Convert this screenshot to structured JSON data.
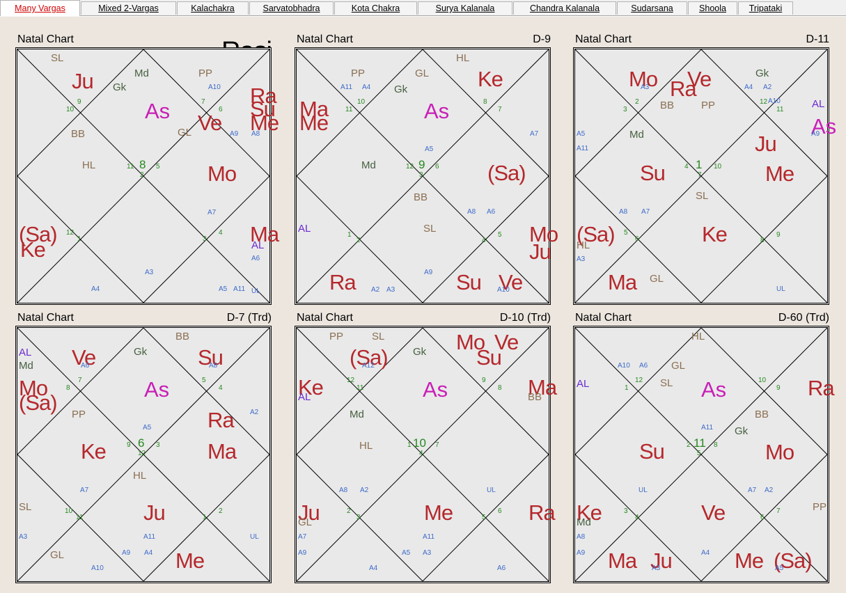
{
  "tabs": [
    {
      "label": "Many Vargas",
      "active": true
    },
    {
      "label": "Mixed 2-Vargas"
    },
    {
      "label": "Kalachakra"
    },
    {
      "label": "Sarvatobhadra"
    },
    {
      "label": "Kota Chakra"
    },
    {
      "label": "Surya Kalanala"
    },
    {
      "label": "Chandra Kalanala"
    },
    {
      "label": "Sudarsana"
    },
    {
      "label": "Shoola"
    },
    {
      "label": "Tripataki"
    }
  ],
  "colors": {
    "planet": "#b5282c",
    "ascendant": "#c81fb6",
    "special_lagna": "#8b6f52",
    "arudha": "#3d6bc9",
    "house_number": "#26881f",
    "arudha_lagna": "#6b2bd0",
    "chart_bg": "#e9e9e9",
    "window_bg": "#ece6df"
  },
  "charts": [
    {
      "title": "Natal Chart",
      "varga": "Rasi",
      "items": [
        {
          "t": "SL",
          "c": "spec"
        },
        {
          "t": "Ju",
          "c": "planet"
        },
        {
          "t": "Md",
          "c": "spec2"
        },
        {
          "t": "Gk",
          "c": "spec2"
        },
        {
          "t": "PP",
          "c": "spec"
        },
        {
          "t": "A10",
          "c": "arud"
        },
        {
          "t": "Ra",
          "c": "planet"
        },
        {
          "t": "Su",
          "c": "planet"
        },
        {
          "t": "Me",
          "c": "planet"
        },
        {
          "t": "9",
          "c": "hn"
        },
        {
          "t": "10",
          "c": "hn"
        },
        {
          "t": "7",
          "c": "hn"
        },
        {
          "t": "6",
          "c": "hn"
        },
        {
          "t": "As",
          "c": "asc"
        },
        {
          "t": "BB",
          "c": "spec"
        },
        {
          "t": "Ve",
          "c": "planet"
        },
        {
          "t": "GL",
          "c": "spec"
        },
        {
          "t": "A9",
          "c": "arud"
        },
        {
          "t": "A8",
          "c": "arud"
        },
        {
          "t": "HL",
          "c": "spec"
        },
        {
          "t": "11",
          "c": "hn"
        },
        {
          "t": "8",
          "c": "hbig"
        },
        {
          "t": "5",
          "c": "hn"
        },
        {
          "t": "2",
          "c": "hn"
        },
        {
          "t": "Mo",
          "c": "planet"
        },
        {
          "t": "A7",
          "c": "arud"
        },
        {
          "t": "(Sa)",
          "c": "planet"
        },
        {
          "t": "Ke",
          "c": "planet"
        },
        {
          "t": "12",
          "c": "hn"
        },
        {
          "t": "1",
          "c": "hn"
        },
        {
          "t": "3",
          "c": "hn"
        },
        {
          "t": "4",
          "c": "hn"
        },
        {
          "t": "Ma",
          "c": "planet"
        },
        {
          "t": "AL",
          "c": "alp"
        },
        {
          "t": "A6",
          "c": "arud"
        },
        {
          "t": "A3",
          "c": "arud"
        },
        {
          "t": "A4",
          "c": "arud"
        },
        {
          "t": "A5",
          "c": "arud"
        },
        {
          "t": "A11",
          "c": "arud"
        },
        {
          "t": "UL",
          "c": "arud"
        }
      ]
    },
    {
      "title": "Natal Chart",
      "varga": "D-9",
      "items": [
        {
          "t": "HL",
          "c": "spec"
        },
        {
          "t": "PP",
          "c": "spec"
        },
        {
          "t": "GL",
          "c": "spec"
        },
        {
          "t": "Ke",
          "c": "planet"
        },
        {
          "t": "A11",
          "c": "arud"
        },
        {
          "t": "A4",
          "c": "arud"
        },
        {
          "t": "Gk",
          "c": "spec2"
        },
        {
          "t": "10",
          "c": "hn"
        },
        {
          "t": "11",
          "c": "hn"
        },
        {
          "t": "8",
          "c": "hn"
        },
        {
          "t": "7",
          "c": "hn"
        },
        {
          "t": "Ma",
          "c": "planet"
        },
        {
          "t": "Me",
          "c": "planet"
        },
        {
          "t": "As",
          "c": "asc"
        },
        {
          "t": "A7",
          "c": "arud"
        },
        {
          "t": "A5",
          "c": "arud"
        },
        {
          "t": "Md",
          "c": "spec2"
        },
        {
          "t": "12",
          "c": "hn"
        },
        {
          "t": "9",
          "c": "hbig"
        },
        {
          "t": "6",
          "c": "hn"
        },
        {
          "t": "3",
          "c": "hn"
        },
        {
          "t": "(Sa)",
          "c": "planet"
        },
        {
          "t": "BB",
          "c": "spec"
        },
        {
          "t": "A8",
          "c": "arud"
        },
        {
          "t": "A6",
          "c": "arud"
        },
        {
          "t": "AL",
          "c": "alp"
        },
        {
          "t": "SL",
          "c": "spec"
        },
        {
          "t": "1",
          "c": "hn"
        },
        {
          "t": "5",
          "c": "hn"
        },
        {
          "t": "2",
          "c": "hn"
        },
        {
          "t": "4",
          "c": "hn"
        },
        {
          "t": "Mo",
          "c": "planet"
        },
        {
          "t": "Ju",
          "c": "planet"
        },
        {
          "t": "A9",
          "c": "arud"
        },
        {
          "t": "Ra",
          "c": "planet"
        },
        {
          "t": "A2",
          "c": "arud"
        },
        {
          "t": "A3",
          "c": "arud"
        },
        {
          "t": "Su",
          "c": "planet"
        },
        {
          "t": "Ve",
          "c": "planet"
        },
        {
          "t": "A10",
          "c": "arud"
        }
      ]
    },
    {
      "title": "Natal Chart",
      "varga": "D-11",
      "items": [
        {
          "t": "Mo",
          "c": "planet"
        },
        {
          "t": "A3",
          "c": "arud"
        },
        {
          "t": "Ve",
          "c": "planet"
        },
        {
          "t": "Ra",
          "c": "planet"
        },
        {
          "t": "Gk",
          "c": "spec2"
        },
        {
          "t": "A4",
          "c": "arud"
        },
        {
          "t": "A2",
          "c": "arud"
        },
        {
          "t": "BB",
          "c": "spec"
        },
        {
          "t": "2",
          "c": "hn"
        },
        {
          "t": "3",
          "c": "hn"
        },
        {
          "t": "12",
          "c": "hn"
        },
        {
          "t": "A10",
          "c": "arud"
        },
        {
          "t": "11",
          "c": "hn"
        },
        {
          "t": "PP",
          "c": "spec"
        },
        {
          "t": "AL",
          "c": "alp"
        },
        {
          "t": "As",
          "c": "asc"
        },
        {
          "t": "A9",
          "c": "arud"
        },
        {
          "t": "A5",
          "c": "arud"
        },
        {
          "t": "A11",
          "c": "arud"
        },
        {
          "t": "Md",
          "c": "spec2"
        },
        {
          "t": "Ju",
          "c": "planet"
        },
        {
          "t": "Su",
          "c": "planet"
        },
        {
          "t": "4",
          "c": "hn"
        },
        {
          "t": "1",
          "c": "hbig"
        },
        {
          "t": "10",
          "c": "hn"
        },
        {
          "t": "7",
          "c": "hn"
        },
        {
          "t": "Me",
          "c": "planet"
        },
        {
          "t": "SL",
          "c": "spec"
        },
        {
          "t": "A8",
          "c": "arud"
        },
        {
          "t": "A7",
          "c": "arud"
        },
        {
          "t": "(Sa)",
          "c": "planet"
        },
        {
          "t": "HL",
          "c": "spec"
        },
        {
          "t": "5",
          "c": "hn"
        },
        {
          "t": "6",
          "c": "hn"
        },
        {
          "t": "Ke",
          "c": "planet"
        },
        {
          "t": "9",
          "c": "hn"
        },
        {
          "t": "8",
          "c": "hn"
        },
        {
          "t": "A3",
          "c": "arud"
        },
        {
          "t": "Ma",
          "c": "planet"
        },
        {
          "t": "GL",
          "c": "spec"
        },
        {
          "t": "UL",
          "c": "arud"
        }
      ]
    },
    {
      "title": "Natal Chart",
      "varga": "D-7 (Trd)",
      "items": [
        {
          "t": "BB",
          "c": "spec"
        },
        {
          "t": "AL",
          "c": "alp"
        },
        {
          "t": "Md",
          "c": "spec2"
        },
        {
          "t": "Ve",
          "c": "planet"
        },
        {
          "t": "A6",
          "c": "arud"
        },
        {
          "t": "Gk",
          "c": "spec2"
        },
        {
          "t": "Su",
          "c": "planet"
        },
        {
          "t": "A8",
          "c": "arud"
        },
        {
          "t": "7",
          "c": "hn"
        },
        {
          "t": "8",
          "c": "hn"
        },
        {
          "t": "5",
          "c": "hn"
        },
        {
          "t": "4",
          "c": "hn"
        },
        {
          "t": "Mo",
          "c": "planet"
        },
        {
          "t": "(Sa)",
          "c": "planet"
        },
        {
          "t": "PP",
          "c": "spec"
        },
        {
          "t": "As",
          "c": "asc"
        },
        {
          "t": "A2",
          "c": "arud"
        },
        {
          "t": "A5",
          "c": "arud"
        },
        {
          "t": "Ra",
          "c": "planet"
        },
        {
          "t": "Ke",
          "c": "planet"
        },
        {
          "t": "9",
          "c": "hn"
        },
        {
          "t": "6",
          "c": "hbig"
        },
        {
          "t": "3",
          "c": "hn"
        },
        {
          "t": "12",
          "c": "hn"
        },
        {
          "t": "Ma",
          "c": "planet"
        },
        {
          "t": "HL",
          "c": "spec"
        },
        {
          "t": "A7",
          "c": "arud"
        },
        {
          "t": "SL",
          "c": "spec"
        },
        {
          "t": "10",
          "c": "hn"
        },
        {
          "t": "11",
          "c": "hn"
        },
        {
          "t": "Ju",
          "c": "planet"
        },
        {
          "t": "2",
          "c": "hn"
        },
        {
          "t": "1",
          "c": "hn"
        },
        {
          "t": "A3",
          "c": "arud"
        },
        {
          "t": "A11",
          "c": "arud"
        },
        {
          "t": "UL",
          "c": "arud"
        },
        {
          "t": "GL",
          "c": "spec"
        },
        {
          "t": "A9",
          "c": "arud"
        },
        {
          "t": "A4",
          "c": "arud"
        },
        {
          "t": "A10",
          "c": "arud"
        },
        {
          "t": "Me",
          "c": "planet"
        }
      ]
    },
    {
      "title": "Natal Chart",
      "varga": "D-10 (Trd)",
      "items": [
        {
          "t": "PP",
          "c": "spec"
        },
        {
          "t": "SL",
          "c": "spec"
        },
        {
          "t": "(Sa)",
          "c": "planet"
        },
        {
          "t": "A12",
          "c": "arud"
        },
        {
          "t": "Gk",
          "c": "spec2"
        },
        {
          "t": "Mo",
          "c": "planet"
        },
        {
          "t": "Ve",
          "c": "planet"
        },
        {
          "t": "Su",
          "c": "planet"
        },
        {
          "t": "12",
          "c": "hn"
        },
        {
          "t": "11",
          "c": "hn"
        },
        {
          "t": "9",
          "c": "hn"
        },
        {
          "t": "8",
          "c": "hn"
        },
        {
          "t": "Ke",
          "c": "planet"
        },
        {
          "t": "AL",
          "c": "alp"
        },
        {
          "t": "As",
          "c": "asc"
        },
        {
          "t": "Ma",
          "c": "planet"
        },
        {
          "t": "BB",
          "c": "spec"
        },
        {
          "t": "Md",
          "c": "spec2"
        },
        {
          "t": "HL",
          "c": "spec"
        },
        {
          "t": "1",
          "c": "hn"
        },
        {
          "t": "10",
          "c": "hbig"
        },
        {
          "t": "7",
          "c": "hn"
        },
        {
          "t": "4",
          "c": "hn"
        },
        {
          "t": "A8",
          "c": "arud"
        },
        {
          "t": "A2",
          "c": "arud"
        },
        {
          "t": "UL",
          "c": "arud"
        },
        {
          "t": "Ju",
          "c": "planet"
        },
        {
          "t": "GL",
          "c": "spec"
        },
        {
          "t": "2",
          "c": "hn"
        },
        {
          "t": "3",
          "c": "hn"
        },
        {
          "t": "Me",
          "c": "planet"
        },
        {
          "t": "6",
          "c": "hn"
        },
        {
          "t": "5",
          "c": "hn"
        },
        {
          "t": "Ra",
          "c": "planet"
        },
        {
          "t": "A7",
          "c": "arud"
        },
        {
          "t": "A11",
          "c": "arud"
        },
        {
          "t": "A9",
          "c": "arud"
        },
        {
          "t": "A5",
          "c": "arud"
        },
        {
          "t": "A3",
          "c": "arud"
        },
        {
          "t": "A4",
          "c": "arud"
        },
        {
          "t": "A6",
          "c": "arud"
        }
      ]
    },
    {
      "title": "Natal Chart",
      "varga": "D-60 (Trd)",
      "items": [
        {
          "t": "HL",
          "c": "spec"
        },
        {
          "t": "A10",
          "c": "arud"
        },
        {
          "t": "A6",
          "c": "arud"
        },
        {
          "t": "GL",
          "c": "spec"
        },
        {
          "t": "AL",
          "c": "alp"
        },
        {
          "t": "1",
          "c": "hn"
        },
        {
          "t": "12",
          "c": "hn"
        },
        {
          "t": "SL",
          "c": "spec"
        },
        {
          "t": "10",
          "c": "hn"
        },
        {
          "t": "9",
          "c": "hn"
        },
        {
          "t": "Ra",
          "c": "planet"
        },
        {
          "t": "As",
          "c": "asc"
        },
        {
          "t": "BB",
          "c": "spec"
        },
        {
          "t": "A11",
          "c": "arud"
        },
        {
          "t": "Gk",
          "c": "spec2"
        },
        {
          "t": "Su",
          "c": "planet"
        },
        {
          "t": "2",
          "c": "hn"
        },
        {
          "t": "11",
          "c": "hbig"
        },
        {
          "t": "8",
          "c": "hn"
        },
        {
          "t": "5",
          "c": "hn"
        },
        {
          "t": "Mo",
          "c": "planet"
        },
        {
          "t": "UL",
          "c": "arud"
        },
        {
          "t": "A7",
          "c": "arud"
        },
        {
          "t": "A2",
          "c": "arud"
        },
        {
          "t": "PP",
          "c": "spec"
        },
        {
          "t": "Ke",
          "c": "planet"
        },
        {
          "t": "Md",
          "c": "spec2"
        },
        {
          "t": "3",
          "c": "hn"
        },
        {
          "t": "4",
          "c": "hn"
        },
        {
          "t": "Ve",
          "c": "planet"
        },
        {
          "t": "7",
          "c": "hn"
        },
        {
          "t": "6",
          "c": "hn"
        },
        {
          "t": "A8",
          "c": "arud"
        },
        {
          "t": "A9",
          "c": "arud"
        },
        {
          "t": "A4",
          "c": "arud"
        },
        {
          "t": "Ma",
          "c": "planet"
        },
        {
          "t": "Ju",
          "c": "planet"
        },
        {
          "t": "A3",
          "c": "arud"
        },
        {
          "t": "Me",
          "c": "planet"
        },
        {
          "t": "(Sa)",
          "c": "planet"
        },
        {
          "t": "A5",
          "c": "arud"
        }
      ]
    }
  ]
}
